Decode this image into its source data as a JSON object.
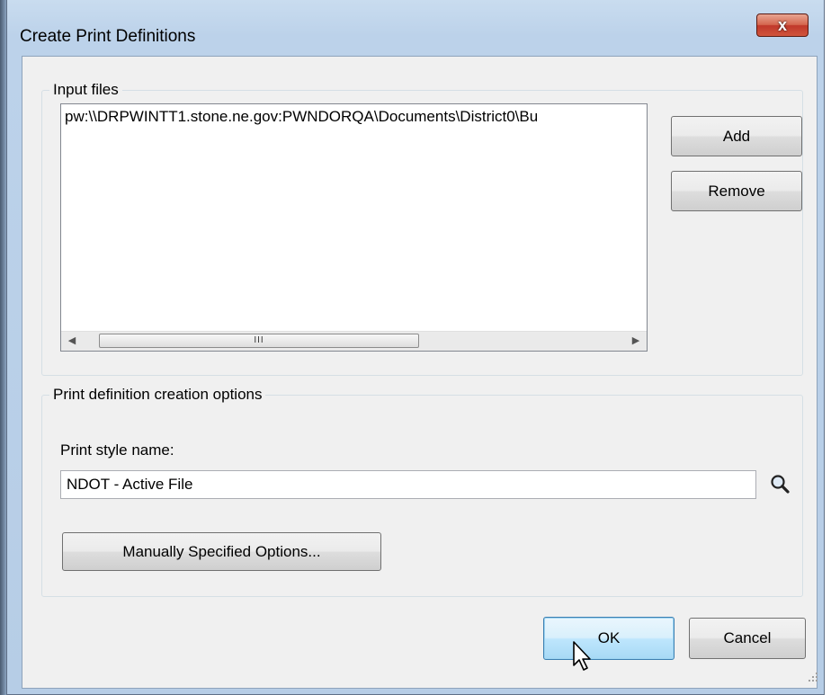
{
  "window": {
    "title": "Create Print Definitions",
    "close_glyph": "x"
  },
  "input_files": {
    "group_label": "Input files",
    "items": [
      "pw:\\\\DRPWINTT1.stone.ne.gov:PWNDORQA\\Documents\\District0\\Bu"
    ],
    "add_label": "Add",
    "remove_label": "Remove",
    "scroll_thumb_grip": "III"
  },
  "options": {
    "group_label": "Print definition creation options",
    "style_name_label": "Print style name:",
    "style_name_value": "NDOT - Active File",
    "manual_options_label": "Manually Specified Options..."
  },
  "footer": {
    "ok_label": "OK",
    "cancel_label": "Cancel"
  },
  "icons": {
    "search": "search-icon",
    "close": "close-icon",
    "cursor": "mouse-pointer-icon"
  },
  "colors": {
    "title_gradient_top": "#c9dcef",
    "close_button": "#c0382a",
    "dialog_background": "#f0f0f0",
    "default_button": "#bee6fd"
  }
}
